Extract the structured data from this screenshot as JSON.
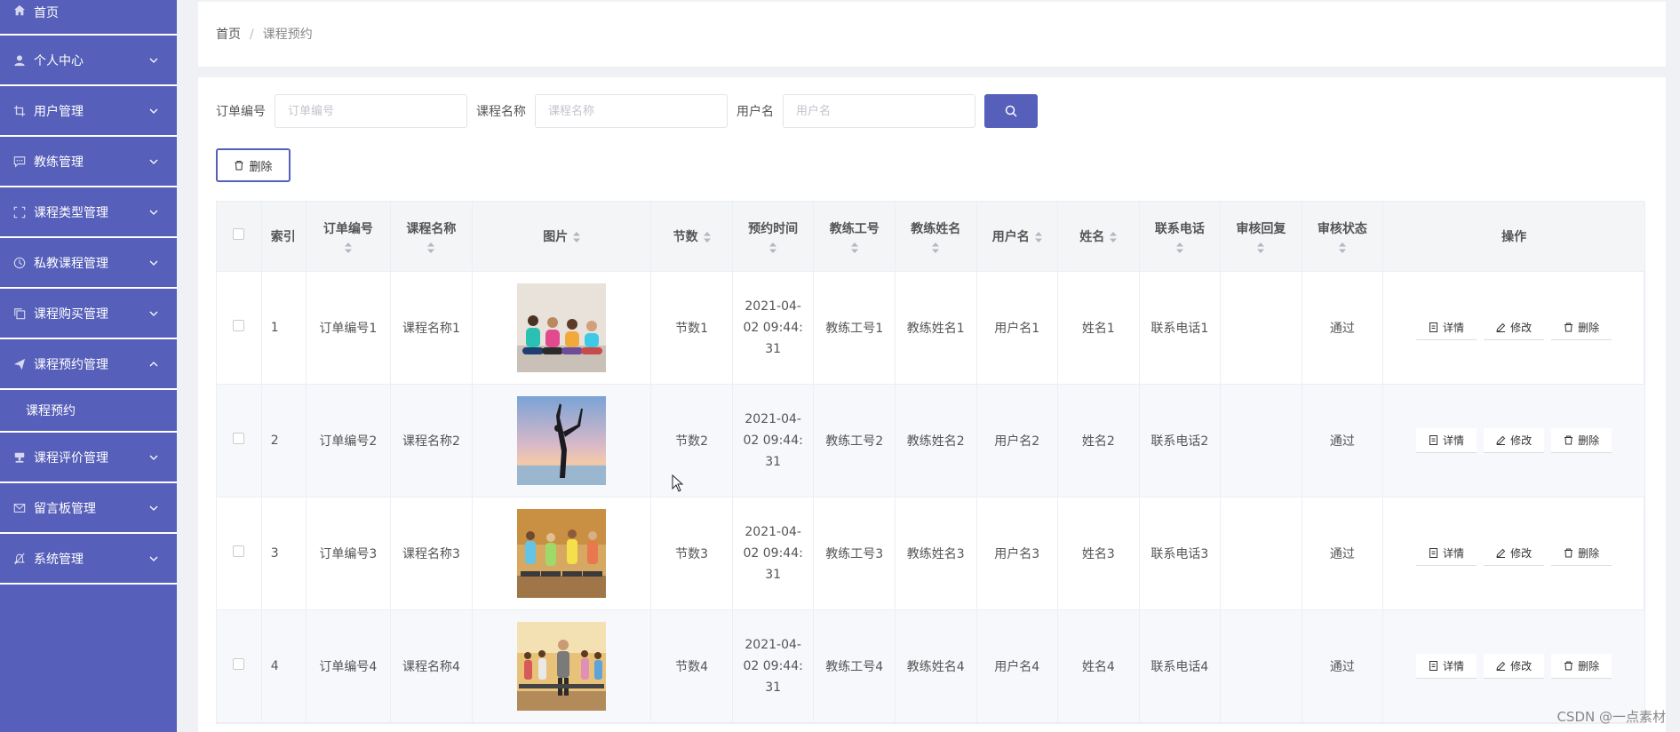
{
  "sidebar": {
    "items": [
      {
        "label": "首页",
        "icon": "home-icon"
      },
      {
        "label": "个人中心",
        "icon": "user-icon"
      },
      {
        "label": "用户管理",
        "icon": "crop-icon"
      },
      {
        "label": "教练管理",
        "icon": "chat-icon"
      },
      {
        "label": "课程类型管理",
        "icon": "frame-icon"
      },
      {
        "label": "私教课程管理",
        "icon": "clock-icon"
      },
      {
        "label": "课程购买管理",
        "icon": "copy-icon"
      },
      {
        "label": "课程预约管理",
        "icon": "send-icon"
      },
      {
        "label": "课程评价管理",
        "icon": "stamp-icon"
      },
      {
        "label": "留言板管理",
        "icon": "mail-icon"
      },
      {
        "label": "系统管理",
        "icon": "bell-off-icon"
      }
    ],
    "submenu": "课程预约"
  },
  "breadcrumb": {
    "home": "首页",
    "separator": "/",
    "current": "课程预约"
  },
  "search": {
    "order_label": "订单编号",
    "order_placeholder": "订单编号",
    "course_label": "课程名称",
    "course_placeholder": "课程名称",
    "user_label": "用户名",
    "user_placeholder": "用户名"
  },
  "toolbar": {
    "delete_label": "删除"
  },
  "table": {
    "headers": {
      "index": "索引",
      "order_no": "订单编号",
      "course_name": "课程名称",
      "image": "图片",
      "sessions": "节数",
      "booking_time": "预约时间",
      "coach_id": "教练工号",
      "coach_name": "教练姓名",
      "username": "用户名",
      "name": "姓名",
      "phone": "联系电话",
      "review_reply": "审核回复",
      "review_status": "审核状态",
      "actions": "操作"
    },
    "actions": {
      "detail": "详情",
      "edit": "修改",
      "delete": "删除"
    },
    "rows": [
      {
        "index": "1",
        "order_no": "订单编号1",
        "course_name": "课程名称1",
        "sessions": "节数1",
        "booking_time": "2021-04-02 09:44:31",
        "coach_id": "教练工号1",
        "coach_name": "教练姓名1",
        "username": "用户名1",
        "name": "姓名1",
        "phone": "联系电话1",
        "review_reply": "",
        "review_status": "通过"
      },
      {
        "index": "2",
        "order_no": "订单编号2",
        "course_name": "课程名称2",
        "sessions": "节数2",
        "booking_time": "2021-04-02 09:44:31",
        "coach_id": "教练工号2",
        "coach_name": "教练姓名2",
        "username": "用户名2",
        "name": "姓名2",
        "phone": "联系电话2",
        "review_reply": "",
        "review_status": "通过"
      },
      {
        "index": "3",
        "order_no": "订单编号3",
        "course_name": "课程名称3",
        "sessions": "节数3",
        "booking_time": "2021-04-02 09:44:31",
        "coach_id": "教练工号3",
        "coach_name": "教练姓名3",
        "username": "用户名3",
        "name": "姓名3",
        "phone": "联系电话3",
        "review_reply": "",
        "review_status": "通过"
      },
      {
        "index": "4",
        "order_no": "订单编号4",
        "course_name": "课程名称4",
        "sessions": "节数4",
        "booking_time": "2021-04-02 09:44:31",
        "coach_id": "教练工号4",
        "coach_name": "教练姓名4",
        "username": "用户名4",
        "name": "姓名4",
        "phone": "联系电话4",
        "review_reply": "",
        "review_status": "通过"
      }
    ]
  },
  "watermark": "CSDN @一点素材",
  "colors": {
    "accent": "#565fb9",
    "border": "#ebeef5",
    "header_bg": "#f4f5f7"
  }
}
